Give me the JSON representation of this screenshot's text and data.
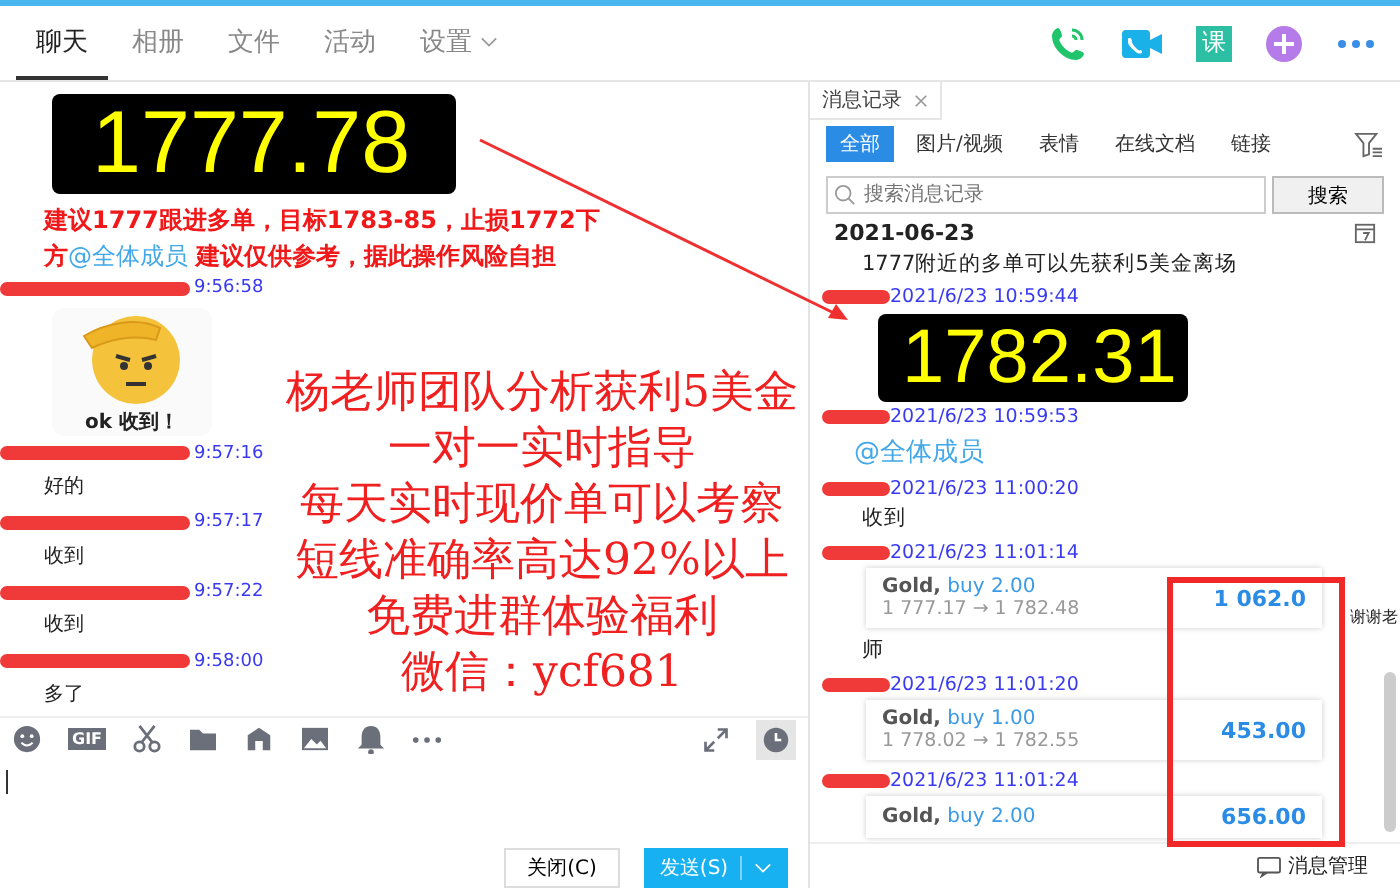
{
  "tabs": [
    {
      "label": "聊天",
      "selected": true,
      "dropdown": false
    },
    {
      "label": "相册",
      "selected": false,
      "dropdown": false
    },
    {
      "label": "文件",
      "selected": false,
      "dropdown": false
    },
    {
      "label": "活动",
      "selected": false,
      "dropdown": false
    },
    {
      "label": "设置",
      "selected": false,
      "dropdown": true
    }
  ],
  "header_icons": {
    "course_label": "课"
  },
  "chat": {
    "messages": [
      {
        "kind": "price",
        "text": "1777.78"
      },
      {
        "kind": "alert",
        "parts": [
          {
            "text": "建议1777跟进多单，目标1783-85，止损1772下方",
            "kind": "text"
          },
          {
            "text": "@全体成员",
            "kind": "mention"
          },
          {
            "text": "  建议仅供参考，据此操作风险自担",
            "kind": "text"
          }
        ]
      },
      {
        "kind": "sticker",
        "time": "9:56:58",
        "text": "ok 收到！"
      },
      {
        "kind": "text",
        "time": "9:57:16",
        "text": "好的"
      },
      {
        "kind": "text",
        "time": "9:57:17",
        "text": "收到"
      },
      {
        "kind": "text",
        "time": "9:57:22",
        "text": "收到"
      },
      {
        "kind": "text",
        "time": "9:58:00",
        "text": "多了"
      }
    ],
    "toolbar": {
      "gif_label": "GIF"
    },
    "buttons": [
      {
        "label": "关闭(C)",
        "kind": "plain"
      },
      {
        "label": "发送(S)",
        "kind": "primary"
      }
    ]
  },
  "history": {
    "title": "消息记录",
    "filters": [
      {
        "label": "全部",
        "selected": true
      },
      {
        "label": "图片/视频",
        "selected": false
      },
      {
        "label": "表情",
        "selected": false
      },
      {
        "label": "在线文档",
        "selected": false
      },
      {
        "label": "链接",
        "selected": false
      }
    ],
    "search": {
      "placeholder": "搜索消息记录",
      "button": "搜索"
    },
    "date": "2021-06-23",
    "entries": [
      {
        "kind": "text",
        "text": "1777附近的多单可以先获利5美金离场"
      },
      {
        "kind": "price",
        "time": "2021/6/23 10:59:44",
        "text": "1782.31"
      },
      {
        "kind": "mention",
        "time": "2021/6/23 10:59:53",
        "text": "@全体成员"
      },
      {
        "kind": "text",
        "time": "2021/6/23 11:00:20",
        "text": "收到"
      },
      {
        "kind": "trade",
        "time": "2021/6/23 11:01:14",
        "symbol": "Gold,",
        "side": "buy 2.00",
        "prices": "1 777.17 → 1 782.48",
        "profit": "1 062.0",
        "note": "谢谢老"
      },
      {
        "kind": "text",
        "text": "师"
      },
      {
        "kind": "trade",
        "time": "2021/6/23 11:01:20",
        "symbol": "Gold,",
        "side": "buy 1.00",
        "prices": "1 778.02 → 1 782.55",
        "profit": "453.00"
      },
      {
        "kind": "trade",
        "time": "2021/6/23 11:01:24",
        "symbol": "Gold,",
        "side": "buy 2.00",
        "profit": "656.00"
      }
    ],
    "footer": "消息管理"
  },
  "overlay_text": [
    "杨老师团队分析获利5美金",
    "一对一实时指导",
    "每天实时现价单可以考察",
    "短线准确率高达92%以上",
    "免费进群体验福利",
    "微信：ycf681"
  ]
}
